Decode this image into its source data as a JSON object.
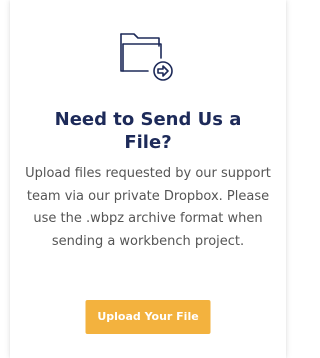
{
  "card": {
    "icon": "folder-arrow-icon",
    "title": "Need to Send Us a File?",
    "description": "Upload files requested by our support team via our private Dropbox. Please use the .wbpz archive format when sending a workbench project.",
    "button_label": "Upload Your File"
  },
  "colors": {
    "title": "#1d2a59",
    "body_text": "#555555",
    "button_bg": "#f3b23e",
    "button_text": "#ffffff",
    "icon_stroke": "#1d2a59"
  }
}
